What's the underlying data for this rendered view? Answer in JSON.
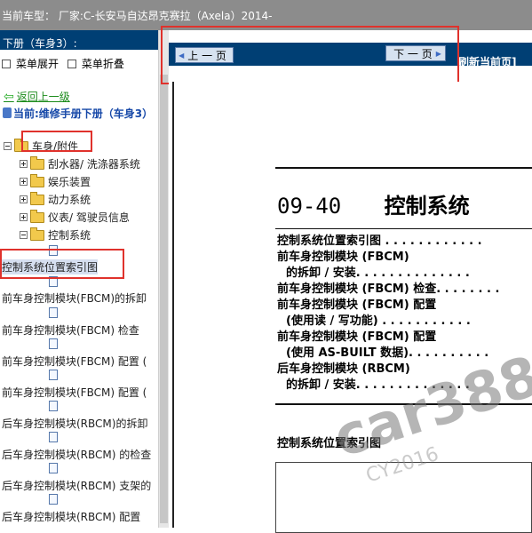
{
  "topbar": {
    "title": "当前车型： 厂家:C-长安马自达昂克赛拉（Axela）2014-"
  },
  "left_panel": {
    "header": "下册（车身3）:",
    "expand_label": "菜单展开",
    "collapse_label": "菜单折叠",
    "back_label": "返回上一级",
    "current_label": "当前:维修手册下册（车身3）",
    "tree": {
      "root": "车身/附件",
      "children": [
        "刮水器/ 洗涤器系统",
        "娱乐装置",
        "动力系统",
        "仪表/ 驾驶员信息",
        "控制系统"
      ],
      "leaves": [
        "控制系统位置索引图",
        "前车身控制模块(FBCM)的拆卸",
        "前车身控制模块(FBCM) 检查",
        "前车身控制模块(FBCM) 配置 (",
        "前车身控制模块(FBCM) 配置 (",
        "后车身控制模块(RBCM)的拆卸",
        "后车身控制模块(RBCM) 的检查",
        "后车身控制模块(RBCM) 支架的",
        "后车身控制模块(RBCM) 配置"
      ]
    }
  },
  "right_panel": {
    "prev_label": "上 一 页",
    "next_label": "下 一 页",
    "refresh_label": "刷新当前页]",
    "doc_number": "09-40",
    "doc_title": "控制系统",
    "toc": [
      "控制系统位置索引图 . . . . . . . . . . . .",
      "前车身控制模块 (FBCM)",
      "的拆卸 / 安装. . . . . . . . . . . . . .",
      "前车身控制模块 (FBCM) 检查. . . . . . . .",
      "前车身控制模块 (FBCM) 配置",
      "(使用读 / 写功能) . . . . . . . . . . .",
      "前车身控制模块 (FBCM) 配置",
      "(使用 AS-BUILT 数据). . . . . . . . . .",
      "后车身控制模块 (RBCM)",
      "的拆卸 / 安装. . . . . . . . . . . . . ."
    ],
    "section_title": "控制系统位置索引图"
  },
  "watermark": {
    "text": "car388",
    "sub": "CY2016"
  }
}
